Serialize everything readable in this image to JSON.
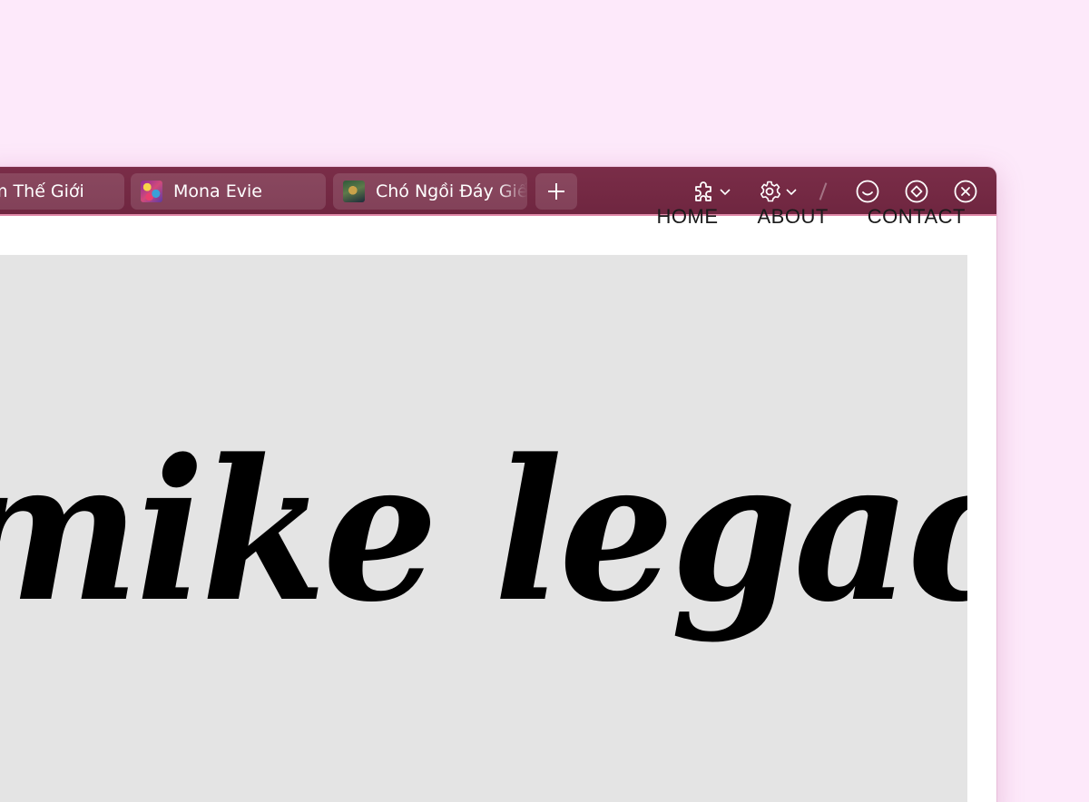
{
  "browser": {
    "tabs": [
      {
        "title": "m Thế Giới",
        "favicon": "none"
      },
      {
        "title": "Mona Evie",
        "favicon": "mona-evie-favicon"
      },
      {
        "title": "Chó Ngồi Đáy Giế",
        "favicon": "cho-ngoi-day-gieng-favicon"
      }
    ],
    "toolbar_icons": [
      "extensions-icon",
      "settings-icon",
      "smile-icon",
      "diamond-icon",
      "close-icon"
    ],
    "colors": {
      "tabbar": "#722942",
      "accent": "#e08aa8"
    }
  },
  "page": {
    "nav": [
      {
        "label": "HOME"
      },
      {
        "label": "ABOUT"
      },
      {
        "label": "CONTACT"
      }
    ],
    "hero": {
      "title": "mike legacy"
    },
    "colors": {
      "background": "#fde9fa",
      "hero": "#e4e4e4",
      "text": "#000000"
    }
  }
}
